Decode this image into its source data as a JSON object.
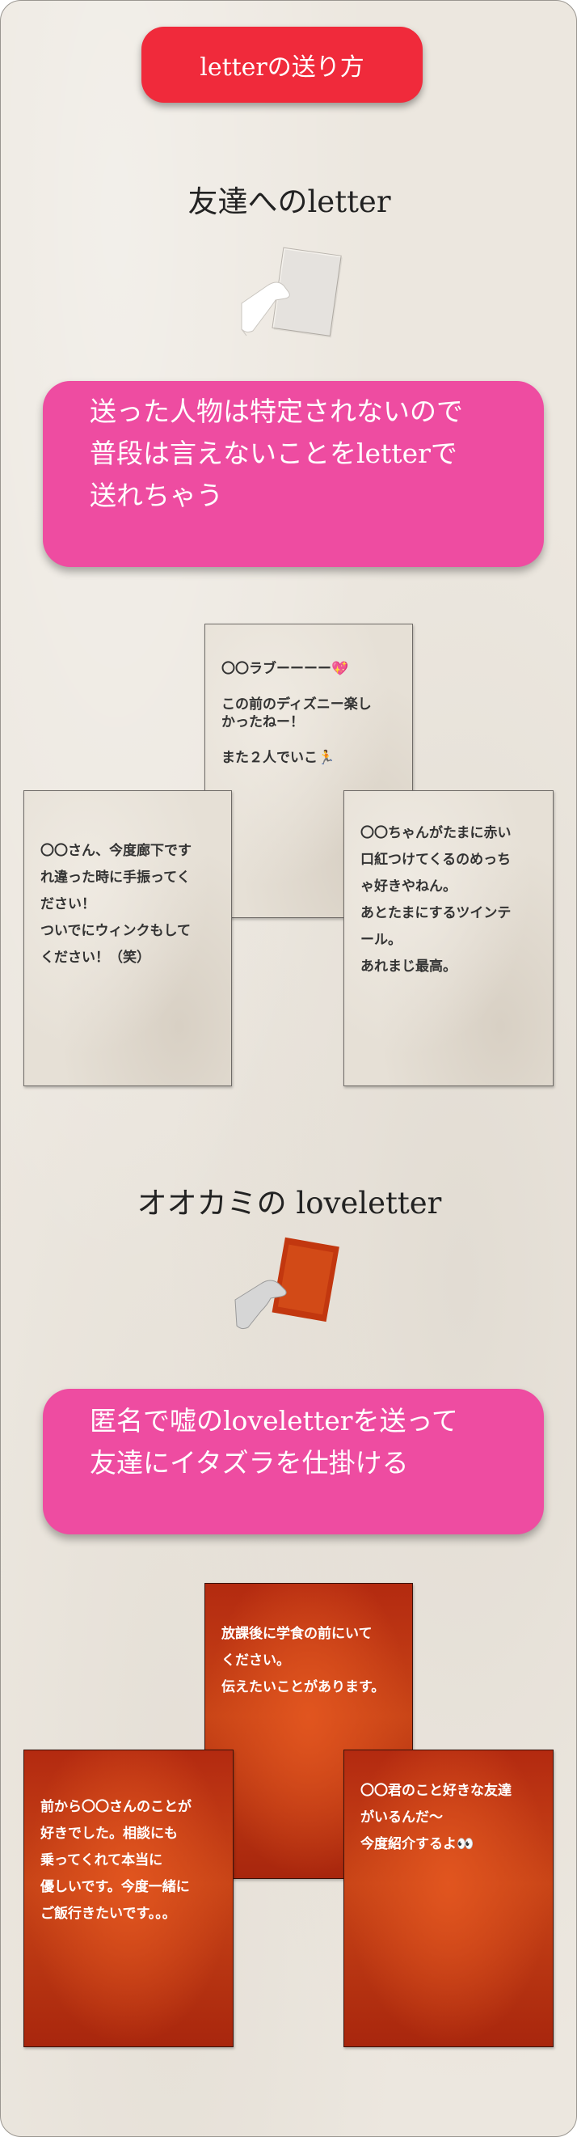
{
  "header": {
    "label": "letterの送り方"
  },
  "friends": {
    "title": "友達へのletter",
    "banner": [
      "送った人物は特定されないので",
      "普段は言えないことをletterで",
      "送れちゃう"
    ],
    "cards": [
      {
        "lines": [
          "〇〇ラブーーーー💖",
          "",
          "この前のディズニー楽し",
          "かったねー！",
          "",
          "また２人でいこ🏃"
        ]
      },
      {
        "lines": [
          "〇〇さん、今度廊下です",
          "れ違った時に手振ってく",
          "ださい！",
          "ついでにウィンクもして",
          "ください！（笑）"
        ]
      },
      {
        "lines": [
          "〇〇ちゃんがたまに赤い",
          "口紅つけてくるのめっち",
          "ゃ好きやねん。",
          "あとたまにするツインテ",
          "ール。",
          "あれまじ最高。"
        ]
      }
    ]
  },
  "wolf": {
    "title": "オオカミの loveletter",
    "banner": [
      "匿名で嘘のloveletterを送って",
      "友達にイタズラを仕掛ける"
    ],
    "cards": [
      {
        "lines": [
          "放課後に学食の前にいて",
          "ください。",
          "伝えたいことがあります。"
        ]
      },
      {
        "lines": [
          "前から〇〇さんのことが",
          "好きでした。相談にも",
          "乗ってくれて本当に",
          "優しいです。今度一緒に",
          "ご飯行きたいです。。。"
        ]
      },
      {
        "lines": [
          "〇〇君のこと好きな友達",
          "がいるんだ〜",
          "今度紹介するよ👀"
        ]
      }
    ]
  },
  "icons": [
    "hand-with-letter-icon",
    "hand-with-red-letter-icon"
  ]
}
